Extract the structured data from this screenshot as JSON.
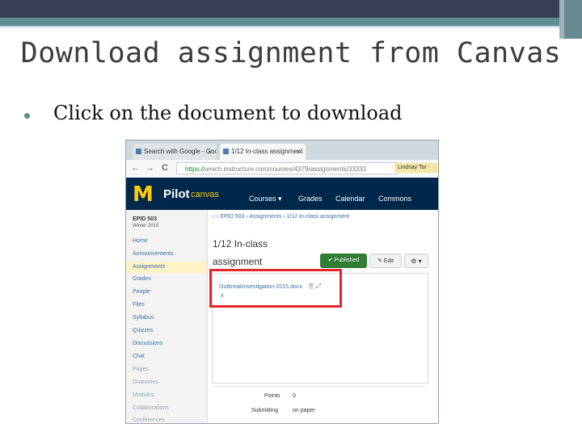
{
  "slide": {
    "title": "Download assignment from Canvas",
    "bullet": "Click on the document to download"
  },
  "browser": {
    "tabs": [
      {
        "label": "Search with Google - Google",
        "close": "×"
      },
      {
        "label": "1/12 In-class assignment",
        "close": "×"
      }
    ],
    "nav": {
      "back": "←",
      "forward": "→",
      "reload": "C"
    },
    "url_secure": "https://",
    "url_rest": "umich.instructure.com/courses/4379/assignments/33333",
    "user": "Lindsay Tor"
  },
  "canvas_header": {
    "logo": "M",
    "pilot": "Pilot",
    "canvas": "canvas",
    "nav": [
      "Courses ▾",
      "Grades",
      "Calendar",
      "Commons"
    ]
  },
  "sidebar": {
    "course": "EPID 503",
    "term": "Winter 2015",
    "items": [
      "Home",
      "Announcements",
      "Assignments",
      "Grades",
      "People",
      "Files",
      "Syllabus",
      "Quizzes",
      "Discussions",
      "Chat",
      "Pages",
      "Outcomes",
      "Modules",
      "Collaborations",
      "Conferences"
    ],
    "active_index": 2
  },
  "breadcrumb": "⌂  ›  EPID 503  ›  Assignments  ›  1/12 In-class assignment",
  "assignment": {
    "title_line1": "1/12 In-class",
    "title_line2": "assignment",
    "published_label": "Published",
    "edit_label": "Edit",
    "gear_label": "⚙ ▾",
    "document_link": "OutbreakInvestigation-2015.docx",
    "document_suffix": "x",
    "doc_icons": "⎘ ⤢",
    "points_label": "Points",
    "points_value": "0",
    "submitting_label": "Submitting",
    "submitting_value": "on paper"
  },
  "colors": {
    "canvas_navy": "#00274c",
    "maize": "#ffcb05",
    "highlight_red": "#e5262a",
    "published_green": "#2e7d32",
    "accent_teal": "#5f8f94"
  }
}
